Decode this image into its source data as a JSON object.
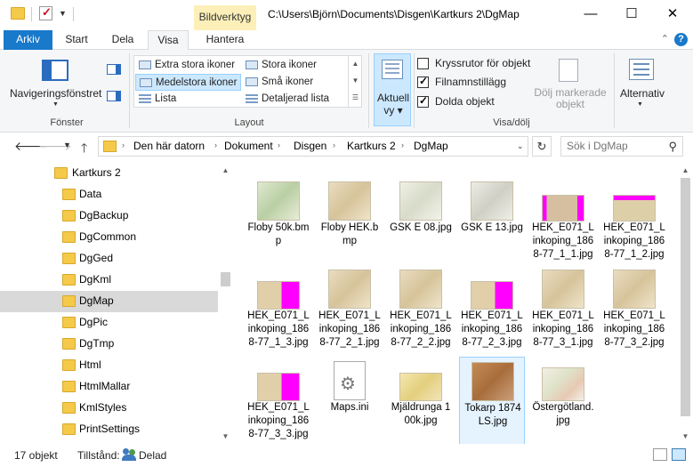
{
  "window": {
    "context_tab": "Bildverktyg",
    "title_path": "C:\\Users\\Björn\\Documents\\Disgen\\Kartkurs 2\\DgMap",
    "minimize": "—",
    "maximize": "☐",
    "close": "✕"
  },
  "ribbon_tabs": {
    "file": "Arkiv",
    "home": "Start",
    "share": "Dela",
    "view": "Visa",
    "manage": "Hantera",
    "collapse": "⌃",
    "help": "?"
  },
  "ribbon": {
    "panes_group": {
      "nav_pane_label": "Navigeringsfönstret",
      "group_label": "Fönster"
    },
    "layout_group": {
      "items": [
        "Extra stora ikoner",
        "Stora ikoner",
        "Medelstora ikoner",
        "Små ikoner",
        "Lista",
        "Detaljerad lista"
      ],
      "selected": "Medelstora ikoner",
      "group_label": "Layout"
    },
    "current_view": {
      "label_line1": "Aktuell",
      "label_line2": "vy"
    },
    "show_hide": {
      "item_checkboxes": {
        "label": "Kryssrutor för objekt",
        "checked": false
      },
      "file_extensions": {
        "label": "Filnamnstillägg",
        "checked": true
      },
      "hidden_items": {
        "label": "Dolda objekt",
        "checked": true
      },
      "hide_selected_line1": "Dölj markerade",
      "hide_selected_line2": "objekt",
      "group_label": "Visa/dölj"
    },
    "options": {
      "label": "Alternativ"
    }
  },
  "address_bar": {
    "crumbs": [
      "Den här datorn",
      "Dokument",
      "Disgen",
      "Kartkurs 2",
      "DgMap"
    ],
    "search_placeholder": "Sök i DgMap"
  },
  "nav_tree": {
    "parent": "Kartkurs 2",
    "children": [
      "Data",
      "DgBackup",
      "DgCommon",
      "DgGed",
      "DgKml",
      "DgMap",
      "DgPic",
      "DgTmp",
      "Html",
      "HtmlMallar",
      "KmlStyles",
      "PrintSettings"
    ],
    "selected": "DgMap"
  },
  "files": [
    {
      "name": "Floby 50k.bmp",
      "thumb": "map-green",
      "selected": false
    },
    {
      "name": "Floby HEK.bmp",
      "thumb": "map-tan",
      "selected": false
    },
    {
      "name": "GSK E 08.jpg",
      "thumb": "map-light",
      "selected": false
    },
    {
      "name": "GSK E 13.jpg",
      "thumb": "map-gray",
      "selected": false
    },
    {
      "name": "HEK_E071_Linkoping_1868-77_1_1.jpg",
      "thumb": "map-magenta",
      "selected": false
    },
    {
      "name": "HEK_E071_Linkoping_1868-77_1_2.jpg",
      "thumb": "map-magenta-top",
      "selected": false
    },
    {
      "name": "HEK_E071_Linkoping_1868-77_1_3.jpg",
      "thumb": "map-magenta-right",
      "selected": false
    },
    {
      "name": "HEK_E071_Linkoping_1868-77_2_1.jpg",
      "thumb": "map-tan",
      "selected": false
    },
    {
      "name": "HEK_E071_Linkoping_1868-77_2_2.jpg",
      "thumb": "map-tan",
      "selected": false
    },
    {
      "name": "HEK_E071_Linkoping_1868-77_2_3.jpg",
      "thumb": "map-magenta-right",
      "selected": false
    },
    {
      "name": "HEK_E071_Linkoping_1868-77_3_1.jpg",
      "thumb": "map-tan",
      "selected": false
    },
    {
      "name": "HEK_E071_Linkoping_1868-77_3_2.jpg",
      "thumb": "map-tan",
      "selected": false
    },
    {
      "name": "HEK_E071_Linkoping_1868-77_3_3.jpg",
      "thumb": "map-magenta-right",
      "selected": false
    },
    {
      "name": "Maps.ini",
      "thumb": "ini-file",
      "selected": false
    },
    {
      "name": "Mjäldrunga 100k.jpg",
      "thumb": "map-yellow",
      "selected": false
    },
    {
      "name": "Tokarp 1874 LS.jpg",
      "thumb": "map-brown",
      "selected": true
    },
    {
      "name": "Östergötland.jpg",
      "thumb": "map-region",
      "selected": false
    }
  ],
  "status": {
    "count": "17 objekt",
    "state_label": "Tillstånd:",
    "state_value": "Delad"
  },
  "colors": {
    "accent": "#1979ca",
    "selection": "#cce8ff",
    "folder": "#f5c94a",
    "magenta_border": "#ff00ff"
  }
}
